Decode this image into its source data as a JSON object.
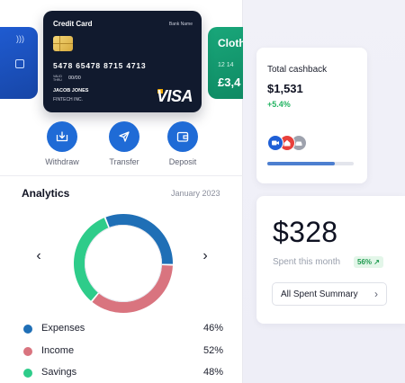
{
  "cards": {
    "left_partial": {
      "color": "#1f5bd1"
    },
    "main": {
      "title": "Credit Card",
      "bank": "Bank Name",
      "number": "5478 65478 8715 4713",
      "valid_label": "VALID THRU",
      "expiry": "00/00",
      "holder": "JACOB JONES",
      "company": "FINTECH INC.",
      "network": "VISA"
    },
    "right_partial": {
      "title": "Cloth",
      "number": "12 14",
      "amount": "£3,4"
    }
  },
  "actions": [
    {
      "label": "Withdraw",
      "icon": "download-icon"
    },
    {
      "label": "Transfer",
      "icon": "send-icon"
    },
    {
      "label": "Deposit",
      "icon": "wallet-icon"
    }
  ],
  "analytics": {
    "title": "Analytics",
    "date": "January 2023",
    "prev_arrow": "‹",
    "next_arrow": "›"
  },
  "chart_data": {
    "type": "pie",
    "categories": [
      "Expenses",
      "Income",
      "Savings"
    ],
    "values": [
      46,
      52,
      48
    ],
    "value_labels": [
      "46%",
      "52%",
      "48%"
    ],
    "colors": [
      "#1f6fb6",
      "#d9747f",
      "#2ecc8a"
    ]
  },
  "cashback": {
    "label": "Total cashback",
    "amount": "$1,531",
    "change": "+5.4%",
    "progress": 0.78,
    "icons": [
      "video-icon",
      "home-icon",
      "car-icon"
    ]
  },
  "spent": {
    "amount": "$328",
    "label": "Spent this month",
    "badge": "56% ↗",
    "button_label": "All Spent Summary",
    "button_chevron": "›"
  }
}
